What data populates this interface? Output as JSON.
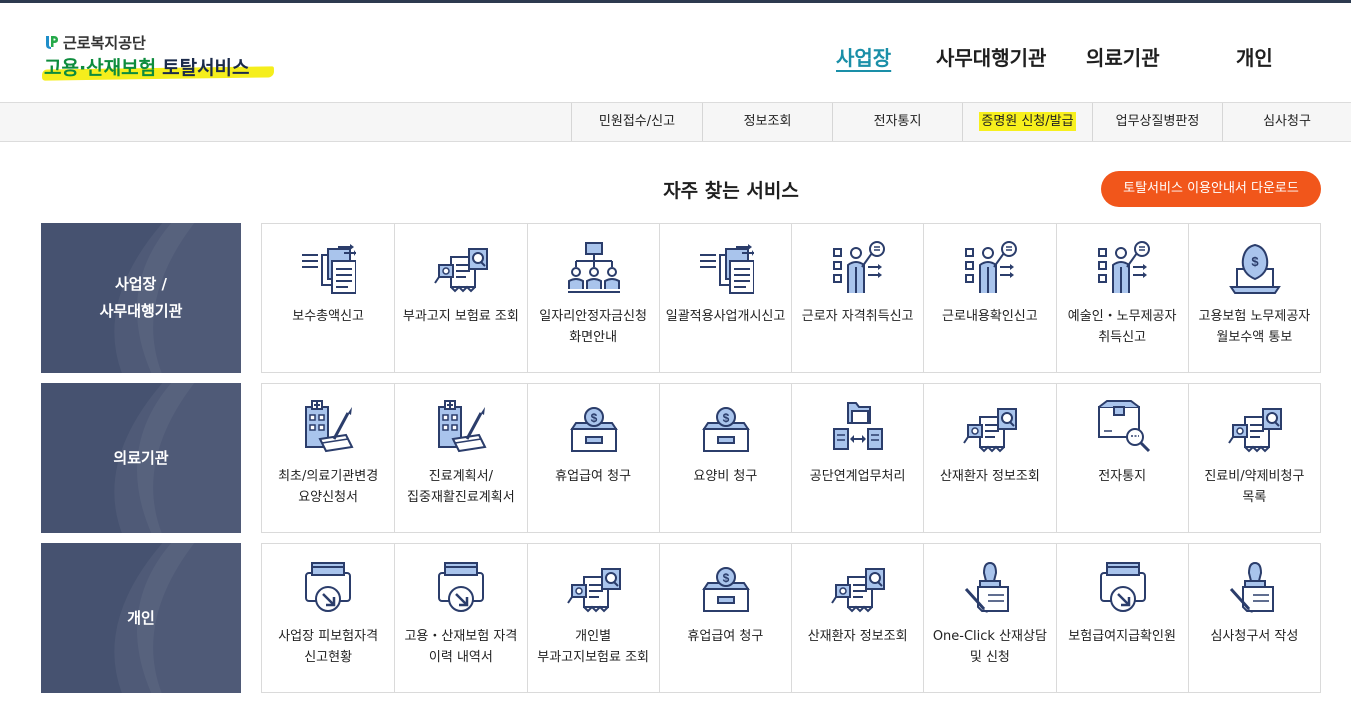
{
  "header": {
    "org_name": "근로복지공단",
    "service_name_part1": "고용·산재보험",
    "service_name_part2": "토탈서비스",
    "gnb": [
      {
        "label": "사업장",
        "active": true
      },
      {
        "label": "사무대행기관",
        "active": false
      },
      {
        "label": "의료기관",
        "active": false
      },
      {
        "label": "개인",
        "active": false
      }
    ]
  },
  "subnav": [
    {
      "label": "민원접수/신고"
    },
    {
      "label": "정보조회"
    },
    {
      "label": "전자통지"
    },
    {
      "label": "증명원 신청/발급",
      "highlight": true
    },
    {
      "label": "업무상질병판정"
    },
    {
      "label": "심사청구"
    }
  ],
  "main": {
    "title": "자주 찾는 서비스",
    "guide_button": "토탈서비스 이용안내서 다운로드"
  },
  "categories": [
    {
      "label_line1": "사업장 /",
      "label_line2": "사무대행기관",
      "services": [
        {
          "label": "보수총액신고",
          "icon": "document-transfer-icon"
        },
        {
          "label": "부과고지 보험료 조회",
          "icon": "receipt-search-icon"
        },
        {
          "label": "일자리안정자금신청 화면안내",
          "icon": "organization-people-icon"
        },
        {
          "label": "일괄적용사업개시신고",
          "icon": "document-transfer-icon"
        },
        {
          "label": "근로자 자격취득신고",
          "icon": "presenter-checklist-icon"
        },
        {
          "label": "근로내용확인신고",
          "icon": "presenter-checklist-icon"
        },
        {
          "label": "예술인・노무제공자 취득신고",
          "icon": "presenter-checklist-icon"
        },
        {
          "label": "고용보험 노무제공자 월보수액 통보",
          "icon": "laptop-money-icon"
        }
      ]
    },
    {
      "label_line1": "의료기관",
      "label_line2": "",
      "services": [
        {
          "label": "최초/의료기관변경 요양신청서",
          "icon": "hospital-form-icon"
        },
        {
          "label": "진료계획서/집중재활진료계획서",
          "icon": "hospital-form-icon"
        },
        {
          "label": "휴업급여 청구",
          "icon": "money-box-icon"
        },
        {
          "label": "요양비 청구",
          "icon": "money-box-icon"
        },
        {
          "label": "공단연계업무처리",
          "icon": "folder-exchange-icon"
        },
        {
          "label": "산재환자 정보조회",
          "icon": "receipt-search-icon"
        },
        {
          "label": "전자통지",
          "icon": "box-search-icon"
        },
        {
          "label": "진료비/약제비청구 목록",
          "icon": "receipt-search-icon"
        }
      ]
    },
    {
      "label_line1": "개인",
      "label_line2": "",
      "services": [
        {
          "label": "사업장 피보험자격 신고현황",
          "icon": "printer-download-icon"
        },
        {
          "label": "고용・산재보험 자격 이력 내역서",
          "icon": "printer-download-icon"
        },
        {
          "label": "개인별 부과고지보험료 조회",
          "icon": "receipt-search-icon"
        },
        {
          "label": "휴업급여 청구",
          "icon": "money-box-icon"
        },
        {
          "label": "산재환자 정보조회",
          "icon": "receipt-search-icon"
        },
        {
          "label": "One-Click 산재상담 및 신청",
          "icon": "stamp-sign-icon"
        },
        {
          "label": "보험급여지급확인원",
          "icon": "printer-download-icon"
        },
        {
          "label": "심사청구서 작성",
          "icon": "stamp-sign-icon"
        }
      ]
    }
  ],
  "colors": {
    "category_bg": "#465270",
    "accent_orange": "#f1561b",
    "gnb_active": "#1a8fa8",
    "highlight_yellow": "#f7f01d",
    "icon_navy": "#2b3d6b",
    "icon_light_blue": "#a9c4ec"
  }
}
